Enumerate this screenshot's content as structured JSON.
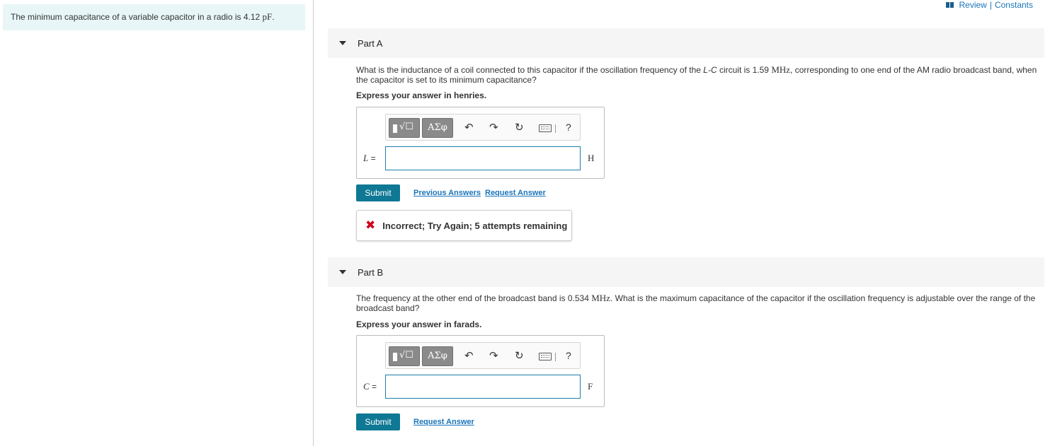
{
  "intro": {
    "text_before": "The minimum capacitance of a variable capacitor in a radio is 4.12 ",
    "value_unit": "pF",
    "text_after": "."
  },
  "top_links": {
    "review": "Review",
    "separator": "|",
    "constants": "Constants"
  },
  "part_a": {
    "title": "Part A",
    "question_1": "What is the inductance of a coil connected to this capacitor if the oscillation frequency of the ",
    "question_lc": "L-C",
    "question_2": " circuit is 1.59 ",
    "question_unit": "MHz",
    "question_3": ", corresponding to one end of the AM radio broadcast band, when the capacitor is set to its minimum capacitance?",
    "express": "Express your answer in henries.",
    "variable": "L",
    "equals": " =",
    "unit": "H",
    "input_value": "",
    "submit_label": "Submit",
    "previous_answers_label": "Previous Answers",
    "request_answer_label": "Request Answer",
    "feedback_text": "Incorrect; Try Again; 5 attempts remaining"
  },
  "part_b": {
    "title": "Part B",
    "question_1": "The frequency at the other end of the broadcast band is 0.534 ",
    "question_unit": "MHz",
    "question_2": ". What is the maximum capacitance of the capacitor if the oscillation frequency is adjustable over the range of the broadcast band?",
    "express": "Express your answer in farads.",
    "variable": "C",
    "equals": " =",
    "unit": "F",
    "input_value": "",
    "submit_label": "Submit",
    "request_answer_label": "Request Answer"
  },
  "toolbar": {
    "templates_glyph": "√☐",
    "greek_label": "ΑΣφ",
    "undo_glyph": "↶",
    "redo_glyph": "↷",
    "reset_glyph": "↻",
    "help_label": "?"
  },
  "icons": {
    "book": "book-icon",
    "templates": "templates-icon",
    "greek": "greek-symbols-icon",
    "undo": "undo-icon",
    "redo": "redo-icon",
    "reset": "reset-icon",
    "keyboard": "keyboard-icon",
    "help": "help-icon",
    "incorrect": "x-icon",
    "collapse": "triangle-down-icon"
  },
  "colors": {
    "accent": "#0f7894",
    "link": "#1a75bb",
    "intro_bg": "#e8f6f7",
    "error": "#d0021b"
  }
}
